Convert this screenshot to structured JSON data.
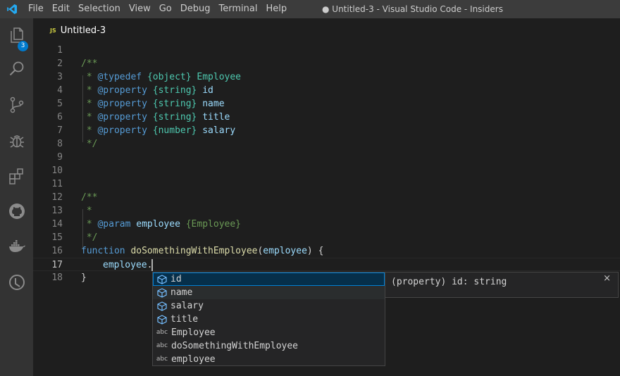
{
  "window": {
    "title": "● Untitled-3 - Visual Studio Code - Insiders",
    "menu": [
      "File",
      "Edit",
      "Selection",
      "View",
      "Go",
      "Debug",
      "Terminal",
      "Help"
    ]
  },
  "activity_bar": {
    "items": [
      {
        "name": "explorer",
        "icon": "files-icon",
        "badge": "3"
      },
      {
        "name": "search",
        "icon": "search-icon"
      },
      {
        "name": "source-control",
        "icon": "source-control-icon"
      },
      {
        "name": "debug",
        "icon": "debug-icon"
      },
      {
        "name": "extensions",
        "icon": "extensions-icon"
      },
      {
        "name": "github",
        "icon": "github-icon"
      },
      {
        "name": "docker",
        "icon": "docker-icon"
      },
      {
        "name": "timeline",
        "icon": "timeline-icon"
      }
    ]
  },
  "tab": {
    "lang_badge": "JS",
    "name": "Untitled-3"
  },
  "editor": {
    "active_line": 17,
    "lines": [
      {
        "n": "1"
      },
      {
        "n": "2"
      },
      {
        "n": "3"
      },
      {
        "n": "4"
      },
      {
        "n": "5"
      },
      {
        "n": "6"
      },
      {
        "n": "7"
      },
      {
        "n": "8"
      },
      {
        "n": "9"
      },
      {
        "n": "10"
      },
      {
        "n": "11"
      },
      {
        "n": "12"
      },
      {
        "n": "13"
      },
      {
        "n": "14"
      },
      {
        "n": "15"
      },
      {
        "n": "16"
      },
      {
        "n": "17"
      },
      {
        "n": "18"
      }
    ],
    "code": {
      "l2": "/**",
      "l3_star": " * ",
      "l3_tag": "@typedef",
      "l3_type": "{object}",
      "l3_name": "Employee",
      "l4_star": " * ",
      "l4_tag": "@property",
      "l4_type": "{string}",
      "l4_name": "id",
      "l5_star": " * ",
      "l5_tag": "@property",
      "l5_type": "{string}",
      "l5_name": "name",
      "l6_star": " * ",
      "l6_tag": "@property",
      "l6_type": "{string}",
      "l6_name": "title",
      "l7_star": " * ",
      "l7_tag": "@property",
      "l7_type": "{number}",
      "l7_name": "salary",
      "l8": " */",
      "l12": "/**",
      "l13": " *",
      "l14_star": " * ",
      "l14_tag": "@param",
      "l14_name": "employee",
      "l14_type": "{Employee}",
      "l15": " */",
      "l16_kw": "function",
      "l16_fn": "doSomethingWithEmployee",
      "l16_open": "(",
      "l16_param": "employee",
      "l16_close": ") {",
      "l17_var": "employee",
      "l17_dot": ".",
      "l18": "}"
    }
  },
  "suggest": {
    "items": [
      {
        "kind": "property",
        "label": "id",
        "match": ""
      },
      {
        "kind": "property",
        "label": "name",
        "match": ""
      },
      {
        "kind": "property",
        "label": "salary",
        "match": ""
      },
      {
        "kind": "property",
        "label": "title",
        "match": ""
      },
      {
        "kind": "word",
        "kind_label": "abc",
        "label": "Employee"
      },
      {
        "kind": "word",
        "kind_label": "abc",
        "label": "doSomethingWithEmployee"
      },
      {
        "kind": "word",
        "kind_label": "abc",
        "label": "employee"
      }
    ],
    "selected": "id",
    "details": "(property) id: string",
    "close_glyph": "×"
  },
  "colors": {
    "accent": "#007acc",
    "comment": "#6a9955",
    "jsdoc_tag": "#569cd6",
    "type": "#4ec9b0",
    "variable": "#9cdcfe",
    "function": "#dcdcaa"
  }
}
